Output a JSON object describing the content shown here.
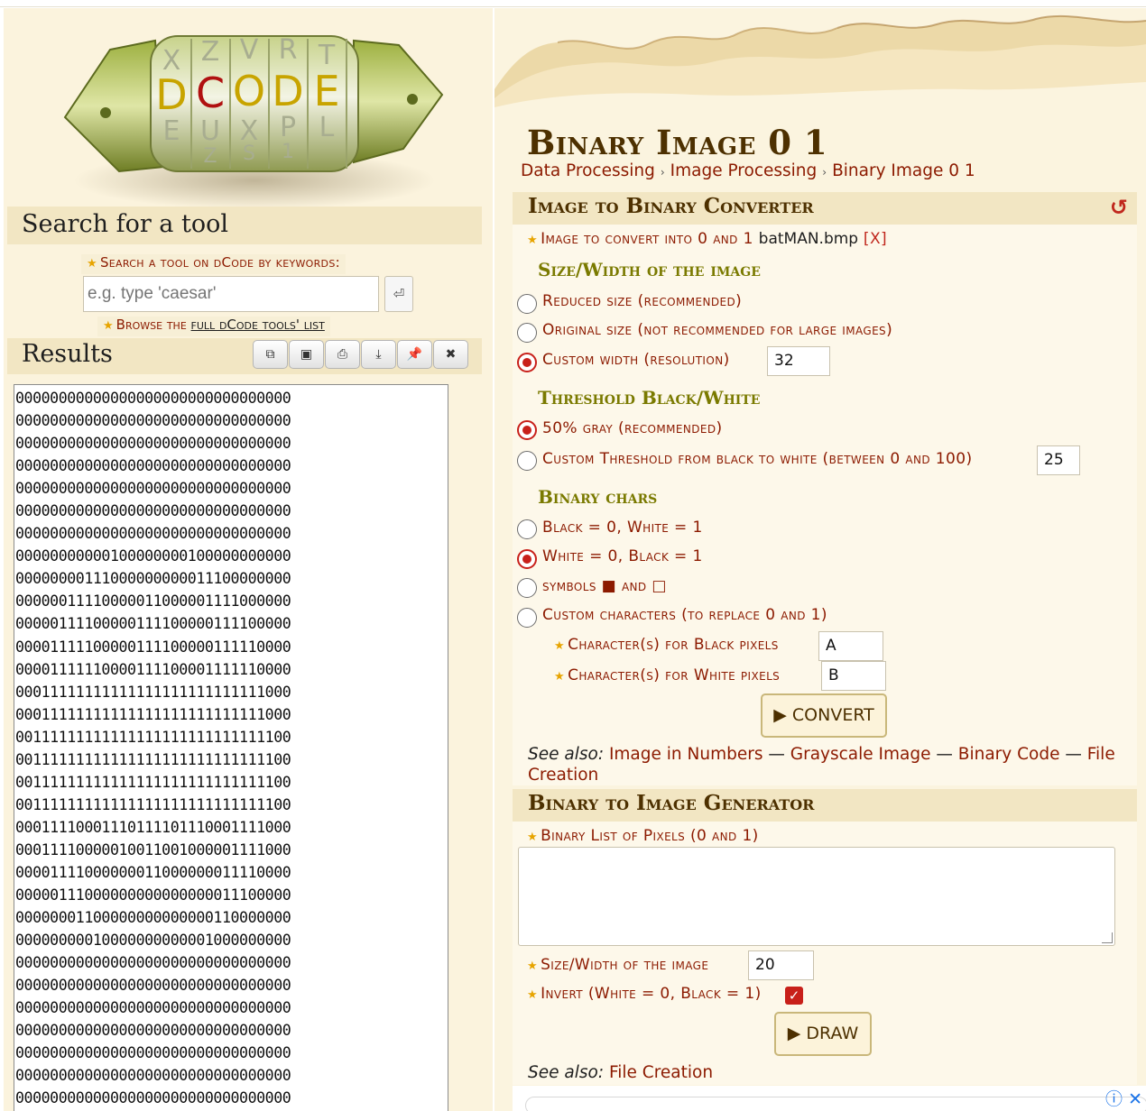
{
  "logo": {
    "text": "DCODE",
    "letters_top": "XZVRT",
    "letters_bottom": "EUXPL",
    "letters_shadow": "IZSIJ"
  },
  "search": {
    "title": "Search for a tool",
    "keywords_label": "Search a tool on dCode by keywords:",
    "placeholder": "e.g. type 'caesar'",
    "go_icon": "enter-icon",
    "browse_prefix": "Browse the ",
    "browse_link": "full dCode tools' list"
  },
  "results": {
    "title": "Results",
    "buttons": [
      "copy-icon",
      "save-icon",
      "print-icon",
      "download-icon",
      "pin-icon",
      "close-icon"
    ],
    "lines": [
      "00000000000000000000000000000000",
      "00000000000000000000000000000000",
      "00000000000000000000000000000000",
      "00000000000000000000000000000000",
      "00000000000000000000000000000000",
      "00000000000000000000000000000000",
      "00000000000000000000000000000000",
      "00000000000100000000100000000000",
      "00000000111000000000011100000000",
      "00000011110000011000001111000000",
      "00000111100000111100000111100000",
      "00001111100000111100000111110000",
      "00001111110000111100001111110000",
      "00011111111111111111111111111000",
      "00011111111111111111111111111000",
      "00111111111111111111111111111100",
      "00111111111111111111111111111100",
      "00111111111111111111111111111100",
      "00111111111111111111111111111100",
      "00011110001110111101110001111000",
      "00011110000010011001000001111000",
      "00001111000000011000000011110000",
      "00000111000000000000000011100000",
      "00000001100000000000000110000000",
      "00000000010000000000001000000000",
      "00000000000000000000000000000000",
      "00000000000000000000000000000000",
      "00000000000000000000000000000000",
      "00000000000000000000000000000000",
      "00000000000000000000000000000000",
      "00000000000000000000000000000000",
      "00000000000000000000000000000000"
    ]
  },
  "page": {
    "title": "Binary Image 0 1",
    "breadcrumbs": [
      "Data Processing",
      "Image Processing",
      "Binary Image 0 1"
    ]
  },
  "converter": {
    "title": "Image to Binary Converter",
    "reset_icon": "reset-icon",
    "image_label": "Image to convert into 0 and 1",
    "file_name": "batMAN.bmp",
    "remove": "[X]",
    "size_title": "Size/Width of the image",
    "size_options": [
      "Reduced size (recommended)",
      "Original size (not recommended for large images)",
      "Custom width (resolution)"
    ],
    "size_selected": 2,
    "custom_width": "32",
    "threshold_title": "Threshold Black/White",
    "threshold_options": [
      "50% gray (recommended)",
      "Custom Threshold from black to white (between 0 and 100)"
    ],
    "threshold_selected": 0,
    "custom_threshold": "25",
    "chars_title": "Binary chars",
    "chars_options": [
      "Black = 0, White = 1",
      "White = 0, Black = 1",
      "symbols ■ and □",
      "Custom characters (to replace 0 and 1)"
    ],
    "chars_selected": 1,
    "black_chars_label": "Character(s) for Black pixels",
    "black_chars_value": "A",
    "white_chars_label": "Character(s) for White pixels",
    "white_chars_value": "B",
    "convert_label": "▶ CONVERT",
    "see_also_label": "See also:",
    "see_also": [
      "Image in Numbers",
      "Grayscale Image",
      "Binary Code",
      "File Creation"
    ]
  },
  "generator": {
    "title": "Binary to Image Generator",
    "list_label": "Binary List of Pixels (0 and 1)",
    "list_value": "",
    "size_label": "Size/Width of the image",
    "size_value": "20",
    "invert_label": "Invert (White = 0, Black = 1)",
    "invert_checked": true,
    "draw_label": "▶ DRAW",
    "see_also_label": "See also:",
    "see_also": [
      "File Creation"
    ]
  },
  "ad": {
    "icons": [
      "ad-info-icon",
      "ad-close-icon"
    ]
  }
}
